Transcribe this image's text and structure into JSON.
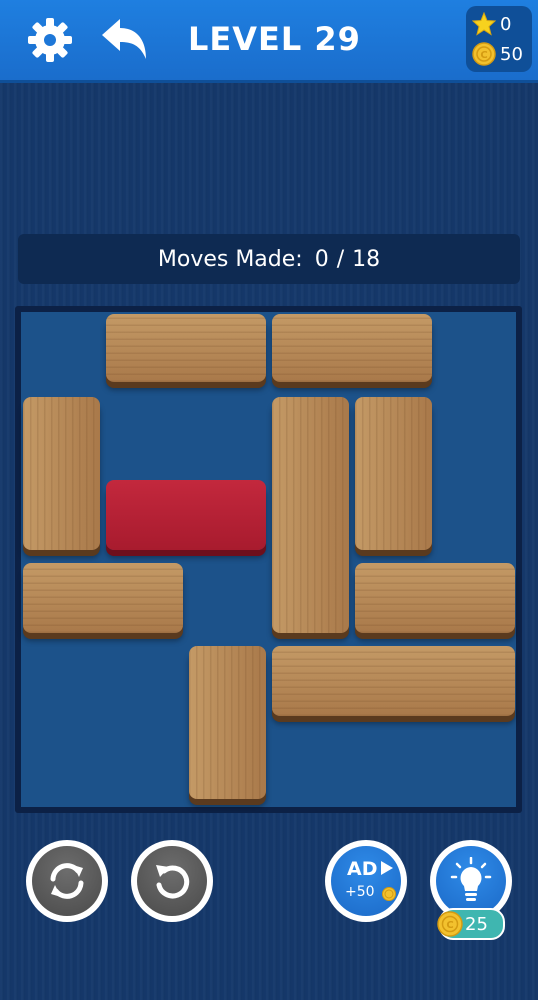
{
  "header": {
    "title": "LEVEL 29",
    "stars": "0",
    "coins": "50"
  },
  "moves": {
    "label": "Moves Made:",
    "current": "0",
    "separator": "/",
    "par": "18"
  },
  "controls": {
    "ad_label": "AD",
    "ad_reward": "+50",
    "hint_cost": "25"
  },
  "icons": {
    "settings": "gear-icon",
    "back": "back-arrow-icon",
    "star": "star-icon",
    "coin": "coin-icon",
    "restart": "restart-icon",
    "undo": "undo-icon",
    "ad_play": "play-icon",
    "hint": "lightbulb-icon"
  },
  "colors": {
    "topbar": "#1f7fe0",
    "board": "#1c528a",
    "wood": "#b88a56",
    "target_block": "#b3213a",
    "coin": "#f2c12e",
    "star": "#f7d21e"
  }
}
